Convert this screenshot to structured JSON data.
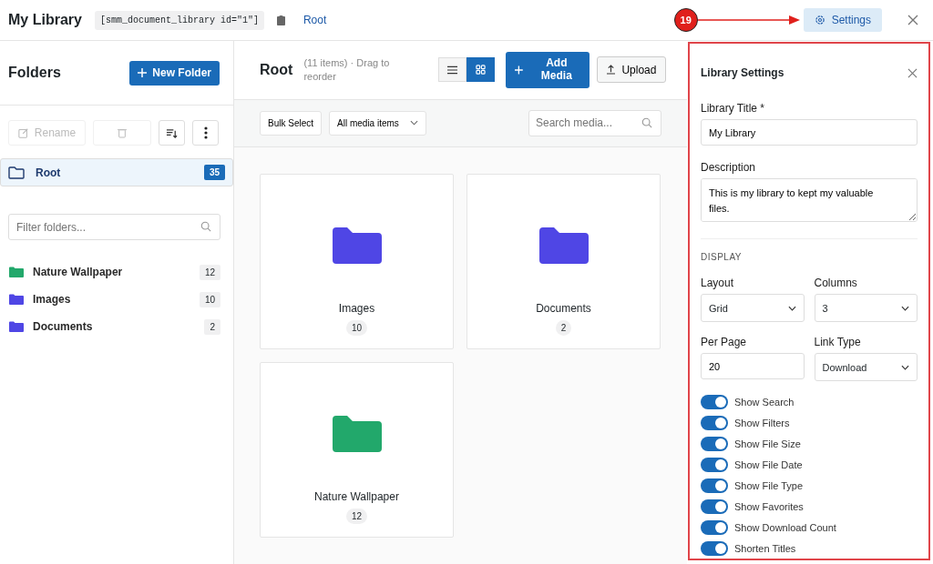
{
  "header": {
    "title": "My Library",
    "shortcode": "[smm_document_library id=\"1\"]",
    "breadcrumb": "Root",
    "settings_button": "Settings"
  },
  "annotation": {
    "number": "19"
  },
  "sidebar": {
    "title": "Folders",
    "new_folder": "New Folder",
    "rename": "Rename",
    "root": {
      "label": "Root",
      "count": "35",
      "selected": true
    },
    "filter": {
      "placeholder": "Filter folders..."
    },
    "folders": [
      {
        "label": "Nature Wallpaper",
        "count": "12",
        "color": "#22a86b",
        "selected": false
      },
      {
        "label": "Images",
        "count": "10",
        "color": "#4f46e5",
        "selected": false
      },
      {
        "label": "Documents",
        "count": "2",
        "color": "#4f46e5",
        "selected": false
      }
    ]
  },
  "main": {
    "title": "Root",
    "info": "(11 items) · Drag to reorder",
    "views": [
      {
        "kind": "list",
        "selected": false
      },
      {
        "kind": "grid",
        "selected": true
      }
    ],
    "add_media": "Add Media",
    "upload": "Upload",
    "bulk_select": "Bulk Select",
    "type_filter": "All media items",
    "search": {
      "placeholder": "Search media..."
    },
    "cards": [
      {
        "label": "Images",
        "count": "10",
        "color": "#4f46e5"
      },
      {
        "label": "Documents",
        "count": "2",
        "color": "#4f46e5"
      },
      {
        "label": "Nature Wallpaper",
        "count": "12",
        "color": "#22a86b"
      }
    ]
  },
  "settings": {
    "title": "Library Settings",
    "library_title_label": "Library Title *",
    "library_title": "My Library",
    "description_label": "Description",
    "description": "This is my library to kept my valuable files.",
    "section": "DISPLAY",
    "layout_label": "Layout",
    "layout": "Grid",
    "columns_label": "Columns",
    "columns": "3",
    "per_page_label": "Per Page",
    "per_page": "20",
    "link_type_label": "Link Type",
    "link_type": "Download",
    "toggles": [
      {
        "label": "Show Search",
        "on": true
      },
      {
        "label": "Show Filters",
        "on": true
      },
      {
        "label": "Show File Size",
        "on": true
      },
      {
        "label": "Show File Date",
        "on": true
      },
      {
        "label": "Show File Type",
        "on": true
      },
      {
        "label": "Show Favorites",
        "on": true
      },
      {
        "label": "Show Download Count",
        "on": true
      },
      {
        "label": "Shorten Titles",
        "on": true
      }
    ]
  }
}
